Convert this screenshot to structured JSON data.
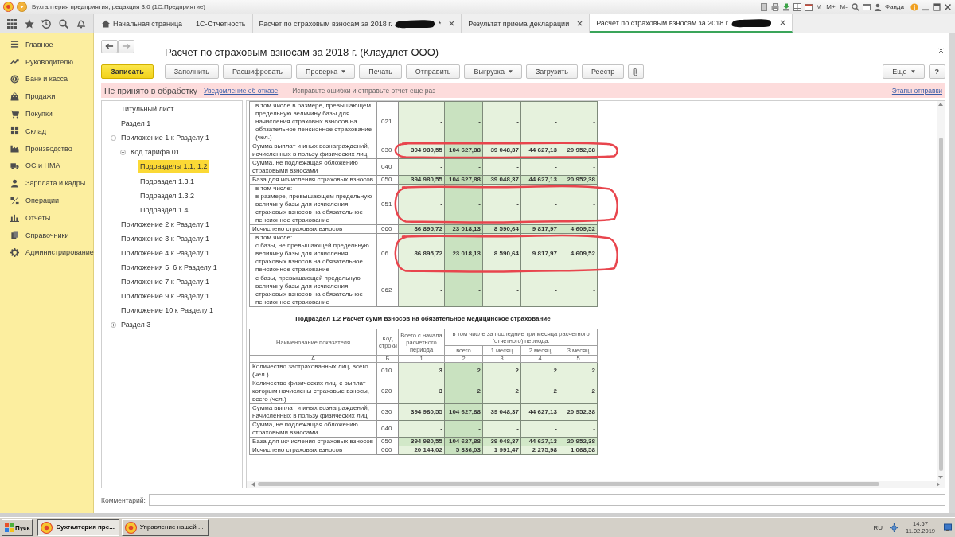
{
  "window": {
    "title": "Бухгалтерия предприятия, редакция 3.0 (1С:Предприятие)",
    "memory_buttons": [
      "M",
      "M+",
      "M-"
    ],
    "user": "Фанда"
  },
  "tabs": [
    {
      "label": "Начальная страница",
      "kind": "home",
      "selected": false,
      "closable": false,
      "redacted": false
    },
    {
      "label": "1С-Отчетность",
      "kind": "document",
      "selected": false,
      "closable": false,
      "redacted": false
    },
    {
      "label": "Расчет по страховым взносам за 2018 г.",
      "kind": "document",
      "selected": false,
      "closable": true,
      "redacted": true,
      "marker": "*"
    },
    {
      "label": "Результат приема декларации",
      "kind": "document",
      "selected": false,
      "closable": true,
      "redacted": false
    },
    {
      "label": "Расчет по страховым взносам за 2018 г.",
      "kind": "document",
      "selected": true,
      "closable": true,
      "redacted": true
    }
  ],
  "sidebar": {
    "items": [
      {
        "label": "Главное"
      },
      {
        "label": "Руководителю"
      },
      {
        "label": "Банк и касса"
      },
      {
        "label": "Продажи"
      },
      {
        "label": "Покупки"
      },
      {
        "label": "Склад"
      },
      {
        "label": "Производство"
      },
      {
        "label": "ОС и НМА"
      },
      {
        "label": "Зарплата и кадры"
      },
      {
        "label": "Операции"
      },
      {
        "label": "Отчеты"
      },
      {
        "label": "Справочники"
      },
      {
        "label": "Администрирование"
      }
    ]
  },
  "form": {
    "title": "Расчет по страховым взносам за 2018 г. (Клаудлет ООО)",
    "toolbar": [
      {
        "label": "Записать",
        "kind": "primary"
      },
      {
        "label": "Заполнить",
        "kind": "plain"
      },
      {
        "label": "Расшифровать",
        "kind": "plain"
      },
      {
        "label": "Проверка",
        "kind": "dropdown"
      },
      {
        "label": "Печать",
        "kind": "plain"
      },
      {
        "label": "Отправить",
        "kind": "plain"
      },
      {
        "label": "Выгрузка",
        "kind": "dropdown"
      },
      {
        "label": "Загрузить",
        "kind": "plain"
      },
      {
        "label": "Реестр",
        "kind": "plain"
      },
      {
        "kind": "attach"
      }
    ],
    "more": "Еще",
    "help": "?",
    "status": {
      "state": "Не принято в обработку",
      "notice_link": "Уведомление об отказе",
      "hint": "Исправьте ошибки и отправьте отчет еще раз",
      "stages_link": "Этапы отправки"
    },
    "tree": [
      {
        "label": "Титульный лист",
        "selected": false
      },
      {
        "label": "Раздел 1",
        "selected": false
      },
      {
        "label": "Приложение 1 к Разделу 1",
        "selected": false,
        "expanded": true,
        "children": [
          {
            "label": "Код тарифа 01",
            "selected": false,
            "expanded": true,
            "children": [
              {
                "label": "Подразделы 1.1, 1.2",
                "selected": true
              },
              {
                "label": "Подраздел 1.3.1",
                "selected": false
              },
              {
                "label": "Подраздел 1.3.2",
                "selected": false
              },
              {
                "label": "Подраздел 1.4",
                "selected": false
              }
            ]
          }
        ]
      },
      {
        "label": "Приложение 2 к Разделу 1",
        "selected": false
      },
      {
        "label": "Приложение 3 к Разделу 1",
        "selected": false
      },
      {
        "label": "Приложение 4 к Разделу 1",
        "selected": false
      },
      {
        "label": "Приложения 5, 6 к Разделу 1",
        "selected": false
      },
      {
        "label": "Приложение 7 к Разделу 1",
        "selected": false
      },
      {
        "label": "Приложение 9 к Разделу 1",
        "selected": false
      },
      {
        "label": "Приложение 10 к Разделу 1",
        "selected": false
      },
      {
        "label": "Раздел 3",
        "selected": false,
        "expanded": false
      }
    ],
    "comment": {
      "label": "Комментарий:"
    }
  },
  "report": {
    "rows": [
      {
        "code": "021",
        "kind": "sub",
        "circled": false,
        "name": "в том числе в размере, превышающем предельную величину базы для начисления страховых взносов на обязательное пенсионное страхование (чел.)",
        "values": [
          "-",
          "-",
          "-",
          "-",
          "-"
        ]
      },
      {
        "code": "030",
        "kind": "main",
        "circled": true,
        "name": "Сумма выплат и иных вознаграждений, исчисленных в пользу физических лиц",
        "values": [
          "394 980,55",
          "104 627,88",
          "39 048,37",
          "44 627,13",
          "20 952,38"
        ]
      },
      {
        "code": "040",
        "kind": "main",
        "circled": false,
        "name": "Сумма, не подлежащая обложению страховыми взносами",
        "values": [
          "-",
          "-",
          "-",
          "-",
          "-"
        ]
      },
      {
        "code": "050",
        "kind": "total",
        "circled": false,
        "name": "База для исчисления страховых взносов",
        "values": [
          "394 980,55",
          "104 627,88",
          "39 048,37",
          "44 627,13",
          "20 952,38"
        ]
      },
      {
        "code": "051",
        "kind": "sub",
        "circled": true,
        "name": "в том числе:\nв размере, превышающем предельную величину базы для исчисления страховых взносов на обязательное пенсионное страхование",
        "values": [
          "-",
          "-",
          "-",
          "-",
          "-"
        ]
      },
      {
        "code": "060",
        "kind": "total",
        "circled": false,
        "name": "Исчислено страховых взносов",
        "values": [
          "86 895,72",
          "23 018,13",
          "8 590,64",
          "9 817,97",
          "4 609,52"
        ]
      },
      {
        "code": "06",
        "kind": "sub",
        "circled": true,
        "name": "в том числе:\nс базы, не превышающей предельную величину базы для исчисления страховых взносов на обязательное пенсионное страхование",
        "values": [
          "86 895,72",
          "23 018,13",
          "8 590,64",
          "9 817,97",
          "4 609,52"
        ]
      },
      {
        "code": "062",
        "kind": "sub",
        "circled": false,
        "name": "с базы, превышающей предельную величину базы для исчисления страховых взносов на обязательное пенсионное страхование",
        "values": [
          "-",
          "-",
          "-",
          "-",
          "-"
        ]
      }
    ],
    "section_title": "Подраздел 1.2 Расчет сумм взносов на обязательное медицинское страхование",
    "table": {
      "columns": {
        "name": "Наименование показателя",
        "code": "Код строки",
        "total": "Всего с начала расчетного периода",
        "group": "в том числе за последние три месяца расчетного (отчетного) периода:",
        "months": [
          "всего",
          "1 месяц",
          "2 месяц",
          "3 месяц"
        ],
        "letters": [
          "А",
          "Б",
          "1",
          "2",
          "3",
          "4",
          "5"
        ]
      },
      "rows": [
        {
          "code": "010",
          "kind": "main",
          "name": "Количество застрахованных лиц, всего (чел.)",
          "values": [
            "3",
            "2",
            "2",
            "2",
            "2"
          ]
        },
        {
          "code": "020",
          "kind": "main",
          "name": "Количество физических лиц, с выплат которым начислены страховые взносы, всего (чел.)",
          "values": [
            "3",
            "2",
            "2",
            "2",
            "2"
          ]
        },
        {
          "code": "030",
          "kind": "main",
          "name": "Сумма выплат и иных вознаграждений, начисленных в пользу физических лиц",
          "values": [
            "394 980,55",
            "104 627,88",
            "39 048,37",
            "44 627,13",
            "20 952,38"
          ]
        },
        {
          "code": "040",
          "kind": "main",
          "name": "Сумма, не подлежащая обложению страховыми взносами",
          "values": [
            "-",
            "-",
            "-",
            "-",
            "-"
          ]
        },
        {
          "code": "050",
          "kind": "total",
          "name": "База для исчисления страховых взносов",
          "values": [
            "394 980,55",
            "104 627,88",
            "39 048,37",
            "44 627,13",
            "20 952,38"
          ]
        },
        {
          "code": "060",
          "kind": "main",
          "name": "Исчислено страховых взносов",
          "values": [
            "20 144,02",
            "5 336,03",
            "1 991,47",
            "2 275,98",
            "1 068,58"
          ]
        }
      ]
    }
  },
  "taskbar": {
    "start": "Пуск",
    "tasks": [
      {
        "label": "Бухгалтерия пре...",
        "selected": true
      },
      {
        "label": "Управление нашей ...",
        "selected": false
      }
    ],
    "language": "RU",
    "time": "14:57",
    "date": "11.02.2019"
  }
}
